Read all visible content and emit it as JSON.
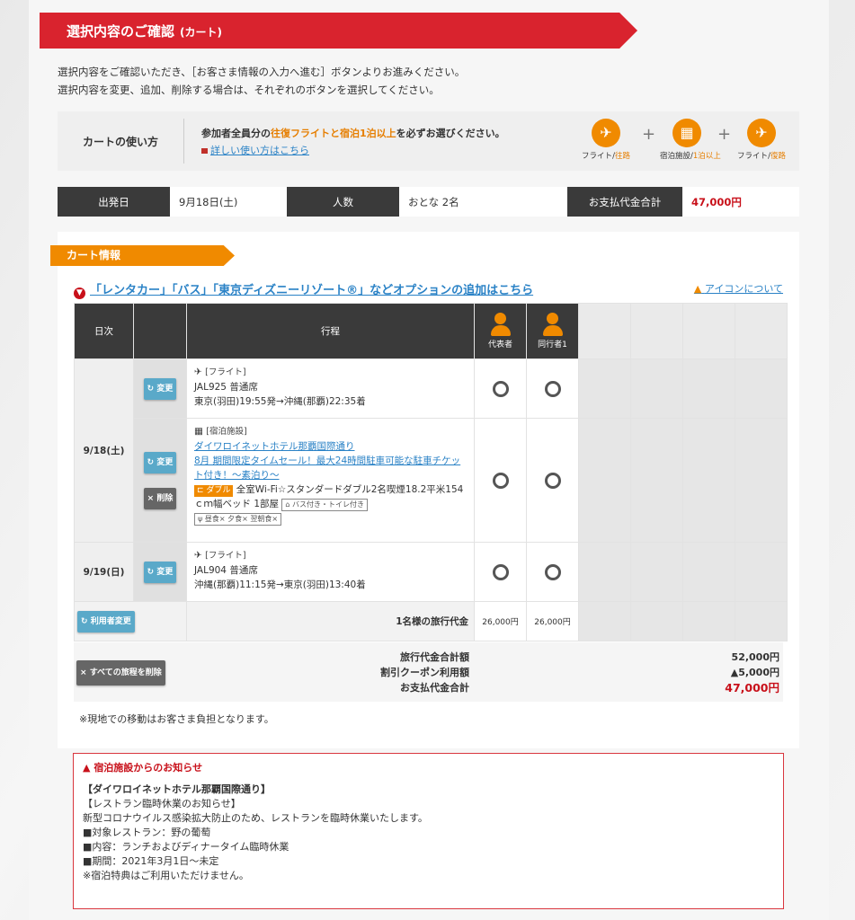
{
  "header": {
    "title": "選択内容のご確認",
    "subtitle": "(カート)"
  },
  "intro": {
    "line1": "選択内容をご確認いただき、［お客さま情報の入力へ進む］ボタンよりお進みください。",
    "line2": "選択内容を変更、追加、削除する場合は、それぞれのボタンを選択してください。"
  },
  "usage": {
    "label": "カートの使い方",
    "text_pre": "参加者全員分の",
    "text_hl": "往復フライトと宿泊1泊以上",
    "text_post": "を必ずお選びください。",
    "link": "詳しい使い方はこちら",
    "icons": [
      {
        "name": "flight-icon",
        "caption": "フライト",
        "sub": "往路"
      },
      {
        "name": "hotel-icon",
        "caption": "宿泊施設",
        "sub": "1泊以上"
      },
      {
        "name": "flight-icon",
        "caption": "フライト",
        "sub": "復路"
      }
    ],
    "plus": "+"
  },
  "summary": {
    "departure_label": "出発日",
    "departure_value": "9月18日(土)",
    "people_label": "人数",
    "people_value": "おとな 2名",
    "total_label": "お支払代金合計",
    "total_value": "47,000円"
  },
  "cart": {
    "tab": "カート情報",
    "option_link": "「レンタカー」「バス」「東京ディズニーリゾート®」などオプションの追加はこちら",
    "icon_about": "アイコンについて",
    "headers": {
      "date": "日次",
      "itinerary": "行程",
      "p1": "代表者",
      "p2": "同行者1"
    },
    "rows": [
      {
        "date": "9/18(土)",
        "type": "[フライト]",
        "line1": "JAL925 普通席",
        "line2": "東京(羽田)19:55発→沖縄(那覇)22:35着",
        "change": "変更"
      },
      {
        "type": "[宿泊施設]",
        "hotel_link": "ダイワロイネットホテル那覇国際通り",
        "plan_link": "8月 期間限定タイムセール！最大24時間駐車可能な駐車チケット付き！～素泊り～",
        "room_tag": "ダブル",
        "room_desc": "全室Wi-Fi☆スタンダードダブル2名喫煙18.2平米154ｃｍ幅ベッド 1部屋",
        "bath": "バス付き・トイレ付き",
        "meals": "昼食× 夕食× 翌朝食×",
        "change": "変更",
        "delete": "削除"
      },
      {
        "date": "9/19(日)",
        "type": "[フライト]",
        "line1": "JAL904 普通席",
        "line2": "沖縄(那覇)11:15発→東京(羽田)13:40着",
        "change": "変更"
      }
    ],
    "user_change": "利用者変更",
    "per_person_label": "1名様の旅行代金",
    "per_person_prices": [
      "26,000円",
      "26,000円"
    ],
    "delete_all": "すべての旅程を削除",
    "totals": {
      "labels": [
        "旅行代金合計額",
        "割引クーポン利用額",
        "お支払代金合計"
      ],
      "values": [
        "52,000円",
        "▲5,000円",
        "47,000円"
      ]
    },
    "note": "※現地での移動はお客さま負担となります。"
  },
  "hotel_notice": {
    "title": "宿泊施設からのお知らせ",
    "lines": [
      "【ダイワロイネットホテル那覇国際通り】",
      "【レストラン臨時休業のお知らせ】",
      "新型コロナウイルス感染拡大防止のため、レストランを臨時休業いたします。",
      "■対象レストラン：野の葡萄",
      "■内容：ランチおよびディナータイム臨時休業",
      "■期間：2021年3月1日～未定",
      "※宿泊特典はご利用いただけません。"
    ]
  },
  "colors": {
    "brand_red": "#d9232e",
    "accent_orange": "#f08a00",
    "link_blue": "#2a82c6"
  }
}
